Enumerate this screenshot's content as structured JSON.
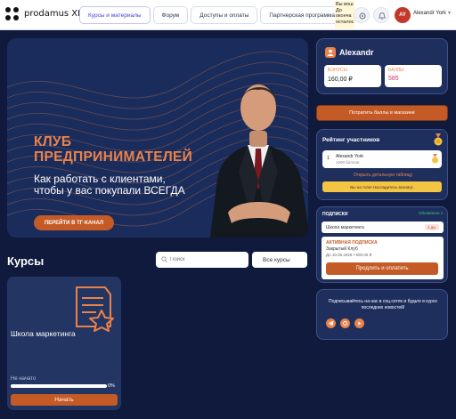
{
  "header": {
    "brand": "prodamus XL",
    "tabs": [
      {
        "label": "Курсы и материалы"
      },
      {
        "label": "Форум"
      },
      {
        "label": "Доступы и оплаты"
      },
      {
        "label": "Партнерская программа"
      }
    ],
    "notice_text": "Вы вош До оконча осталос",
    "avatar_initials": "AY",
    "user_name": "Alexandr York"
  },
  "hero": {
    "title_line1": "КЛУБ",
    "title_line2": "ПРЕДПРИНИМАТЕЛЕЙ",
    "subtitle": "Как работать с клиентами, чтобы у вас покупали ВСЕГДА",
    "button": "ПЕРЕЙТИ В ТГ-КАНАЛ"
  },
  "courses": {
    "heading": "Курсы",
    "search_placeholder": "Поиск",
    "filter_value": "Все курсы",
    "items": [
      {
        "title": "Школа маркетинга",
        "status": "Не начато",
        "progress_pct": 0,
        "progress_label": "0%",
        "button": "Начать"
      }
    ]
  },
  "user_card": {
    "name": "Alexandr",
    "bonus_label": "БОНУСЫ",
    "bonus_value": "160,00 ₽",
    "points_label": "БАЛЛЫ",
    "points_value": "585"
  },
  "spend_button": "Потратить баллы в магазине",
  "rating": {
    "heading": "Рейтинг участников",
    "rank": "1",
    "name": "Alexandr York",
    "points": "1000 баллов",
    "link": "Открыть детальную таблицу",
    "gift_button": "Вы на топе! Насладитесь вознагр."
  },
  "subscriptions": {
    "heading": "ПОДПИСКИ",
    "badge": "Обновлено 1",
    "row_title": "Школа маркетинга",
    "row_badge": "1 дн.",
    "tag": "АКТИВНАЯ ПОДПИСКА",
    "plan": "Закрытый Клуб",
    "date": "До 10.05.2026 • 500.00 ₽",
    "button": "Продлить и оплатить"
  },
  "social": {
    "text": "Подписывайтесь на нас в соц.сетях и будьте в курсе последних новостей!",
    "icons": [
      "telegram-icon",
      "vk-icon",
      "youtube-icon"
    ]
  },
  "colors": {
    "page_bg": "#0f1a3d",
    "card_bg": "#1e2f5e",
    "accent": "#c45a26",
    "accent_light": "#e9834a"
  }
}
